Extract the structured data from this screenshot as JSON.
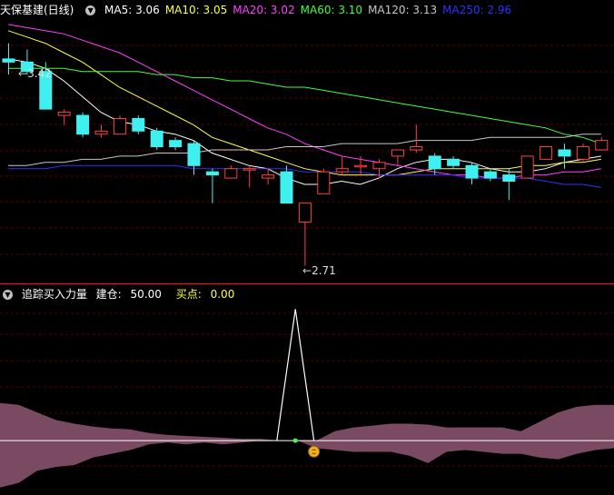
{
  "colors": {
    "background": "#000000",
    "divider": "#c02020",
    "grid": "#5a0000",
    "up": "#ff4040",
    "down": "#40f0f0",
    "ma5": "#ffffff",
    "ma10": "#ffff40",
    "ma20": "#ff40ff",
    "ma60": "#40ff40",
    "ma120": "#c8c8c8",
    "ma250": "#3030ff",
    "lower_fill": "#7a4a62",
    "lower_line": "#ffffff",
    "coin": "#f0b020"
  },
  "main_panel": {
    "title": "天保基建(日线)",
    "legend": [
      {
        "key": "ma5",
        "text": "MA5: 3.06"
      },
      {
        "key": "ma10",
        "text": "MA10: 3.05"
      },
      {
        "key": "ma20",
        "text": "MA20: 3.02"
      },
      {
        "key": "ma60",
        "text": "MA60: 3.10"
      },
      {
        "key": "ma120",
        "text": "MA120: 3.13"
      },
      {
        "key": "ma250",
        "text": "MA250: 2.96"
      }
    ],
    "high_label": "3.42",
    "low_label": "2.71"
  },
  "lower_panel": {
    "title": "追踪买入力量",
    "item1_label": "建仓:",
    "item1_value": "50.00",
    "item2_label": "买点:",
    "item2_value": "0.00"
  },
  "chart_data": [
    {
      "type": "candlestick",
      "ylim": [
        2.66,
        3.5
      ],
      "candles": [
        {
          "o": 3.37,
          "h": 3.42,
          "l": 3.32,
          "c": 3.36
        },
        {
          "o": 3.36,
          "h": 3.4,
          "l": 3.32,
          "c": 3.33
        },
        {
          "o": 3.33,
          "h": 3.36,
          "l": 3.21,
          "c": 3.21
        },
        {
          "o": 3.19,
          "h": 3.21,
          "l": 3.16,
          "c": 3.2
        },
        {
          "o": 3.19,
          "h": 3.2,
          "l": 3.12,
          "c": 3.13
        },
        {
          "o": 3.13,
          "h": 3.16,
          "l": 3.12,
          "c": 3.14
        },
        {
          "o": 3.13,
          "h": 3.19,
          "l": 3.13,
          "c": 3.18
        },
        {
          "o": 3.18,
          "h": 3.19,
          "l": 3.13,
          "c": 3.14
        },
        {
          "o": 3.14,
          "h": 3.15,
          "l": 3.08,
          "c": 3.09
        },
        {
          "o": 3.11,
          "h": 3.12,
          "l": 3.08,
          "c": 3.09
        },
        {
          "o": 3.1,
          "h": 3.11,
          "l": 3.0,
          "c": 3.03
        },
        {
          "o": 3.01,
          "h": 3.02,
          "l": 2.91,
          "c": 3.0
        },
        {
          "o": 2.99,
          "h": 3.03,
          "l": 2.99,
          "c": 3.02
        },
        {
          "o": 3.02,
          "h": 3.03,
          "l": 2.96,
          "c": 3.02
        },
        {
          "o": 2.99,
          "h": 3.02,
          "l": 2.97,
          "c": 3.0
        },
        {
          "o": 3.01,
          "h": 3.03,
          "l": 2.91,
          "c": 2.91
        },
        {
          "o": 2.85,
          "h": 2.91,
          "l": 2.71,
          "c": 2.91
        },
        {
          "o": 2.94,
          "h": 3.02,
          "l": 2.94,
          "c": 3.01
        },
        {
          "o": 3.01,
          "h": 3.06,
          "l": 3.0,
          "c": 3.02
        },
        {
          "o": 3.03,
          "h": 3.06,
          "l": 3.0,
          "c": 3.03
        },
        {
          "o": 3.02,
          "h": 3.05,
          "l": 2.99,
          "c": 3.04
        },
        {
          "o": 3.06,
          "h": 3.08,
          "l": 3.03,
          "c": 3.08
        },
        {
          "o": 3.08,
          "h": 3.16,
          "l": 3.07,
          "c": 3.09
        },
        {
          "o": 3.06,
          "h": 3.07,
          "l": 3.0,
          "c": 3.02
        },
        {
          "o": 3.05,
          "h": 3.06,
          "l": 3.02,
          "c": 3.03
        },
        {
          "o": 3.03,
          "h": 3.04,
          "l": 2.97,
          "c": 2.99
        },
        {
          "o": 3.01,
          "h": 3.02,
          "l": 2.98,
          "c": 2.99
        },
        {
          "o": 3.0,
          "h": 3.02,
          "l": 2.92,
          "c": 2.98
        },
        {
          "o": 2.99,
          "h": 3.06,
          "l": 2.99,
          "c": 3.06
        },
        {
          "o": 3.05,
          "h": 3.09,
          "l": 3.05,
          "c": 3.09
        },
        {
          "o": 3.08,
          "h": 3.1,
          "l": 3.02,
          "c": 3.06
        },
        {
          "o": 3.05,
          "h": 3.1,
          "l": 3.04,
          "c": 3.09
        },
        {
          "o": 3.08,
          "h": 3.12,
          "l": 3.08,
          "c": 3.11
        }
      ],
      "ma_series": [
        {
          "key": "ma5",
          "values": [
            3.37,
            3.36,
            3.34,
            3.3,
            3.25,
            3.2,
            3.17,
            3.16,
            3.14,
            3.13,
            3.11,
            3.07,
            3.05,
            3.03,
            3.02,
            2.99,
            2.97,
            2.97,
            2.98,
            2.97,
            2.99,
            3.02,
            3.04,
            3.05,
            3.05,
            3.04,
            3.02,
            3.01,
            3.01,
            3.02,
            3.04,
            3.05,
            3.06
          ]
        },
        {
          "key": "ma10",
          "values": [
            3.46,
            3.44,
            3.42,
            3.39,
            3.36,
            3.32,
            3.28,
            3.25,
            3.22,
            3.19,
            3.16,
            3.12,
            3.1,
            3.08,
            3.06,
            3.04,
            3.02,
            3.01,
            3.0,
            3.0,
            3.0,
            3.0,
            3.01,
            3.02,
            3.02,
            3.02,
            3.02,
            3.02,
            3.03,
            3.03,
            3.04,
            3.04,
            3.05
          ]
        },
        {
          "key": "ma20",
          "values": [
            3.48,
            3.47,
            3.46,
            3.45,
            3.43,
            3.41,
            3.39,
            3.36,
            3.33,
            3.3,
            3.27,
            3.24,
            3.21,
            3.18,
            3.15,
            3.13,
            3.1,
            3.08,
            3.06,
            3.05,
            3.04,
            3.03,
            3.02,
            3.01,
            3.0,
            3.0,
            2.99,
            2.99,
            3.0,
            3.0,
            3.01,
            3.01,
            3.02
          ]
        },
        {
          "key": "ma60",
          "values": [
            3.34,
            3.34,
            3.34,
            3.34,
            3.33,
            3.33,
            3.33,
            3.33,
            3.32,
            3.32,
            3.31,
            3.31,
            3.3,
            3.3,
            3.29,
            3.28,
            3.28,
            3.27,
            3.26,
            3.25,
            3.24,
            3.23,
            3.22,
            3.21,
            3.2,
            3.19,
            3.18,
            3.17,
            3.16,
            3.15,
            3.13,
            3.12,
            3.1
          ]
        },
        {
          "key": "ma120",
          "values": [
            3.03,
            3.03,
            3.04,
            3.04,
            3.05,
            3.05,
            3.06,
            3.06,
            3.07,
            3.07,
            3.07,
            3.08,
            3.08,
            3.08,
            3.08,
            3.09,
            3.09,
            3.09,
            3.1,
            3.1,
            3.1,
            3.1,
            3.11,
            3.11,
            3.11,
            3.11,
            3.12,
            3.12,
            3.12,
            3.12,
            3.12,
            3.13,
            3.13
          ]
        },
        {
          "key": "ma250",
          "values": [
            3.02,
            3.02,
            3.02,
            3.03,
            3.03,
            3.03,
            3.03,
            3.03,
            3.03,
            3.03,
            3.02,
            3.02,
            3.02,
            3.02,
            3.02,
            3.02,
            3.01,
            3.01,
            3.01,
            3.01,
            3.0,
            3.0,
            3.0,
            3.0,
            3.0,
            2.99,
            2.99,
            2.99,
            2.99,
            2.98,
            2.97,
            2.97,
            2.96
          ]
        }
      ]
    },
    {
      "type": "area",
      "ylim": [
        -55,
        150
      ],
      "baseline": 0,
      "upper": [
        40,
        38,
        30,
        22,
        18,
        15,
        13,
        12,
        8,
        6,
        5,
        4,
        3,
        2,
        2,
        0,
        0,
        0,
        10,
        14,
        16,
        18,
        18,
        17,
        14,
        14,
        14,
        14,
        10,
        20,
        30,
        36,
        38,
        38
      ],
      "lower": [
        -50,
        -45,
        -32,
        -28,
        -26,
        -18,
        -14,
        -10,
        -4,
        -2,
        -4,
        -2,
        -4,
        -2,
        0,
        0,
        0,
        -8,
        -10,
        -12,
        -12,
        -12,
        -16,
        -24,
        -12,
        -10,
        -12,
        -14,
        -14,
        -18,
        -20,
        -14,
        -10,
        -8
      ],
      "spike": {
        "x": [
          14.5,
          15.5,
          16.5
        ],
        "y": [
          0,
          140,
          0
        ]
      },
      "markers": [
        {
          "x": 15.5,
          "y": 0,
          "shape": "dot"
        },
        {
          "x": 16.5,
          "y": -4,
          "shape": "coin"
        }
      ]
    }
  ]
}
